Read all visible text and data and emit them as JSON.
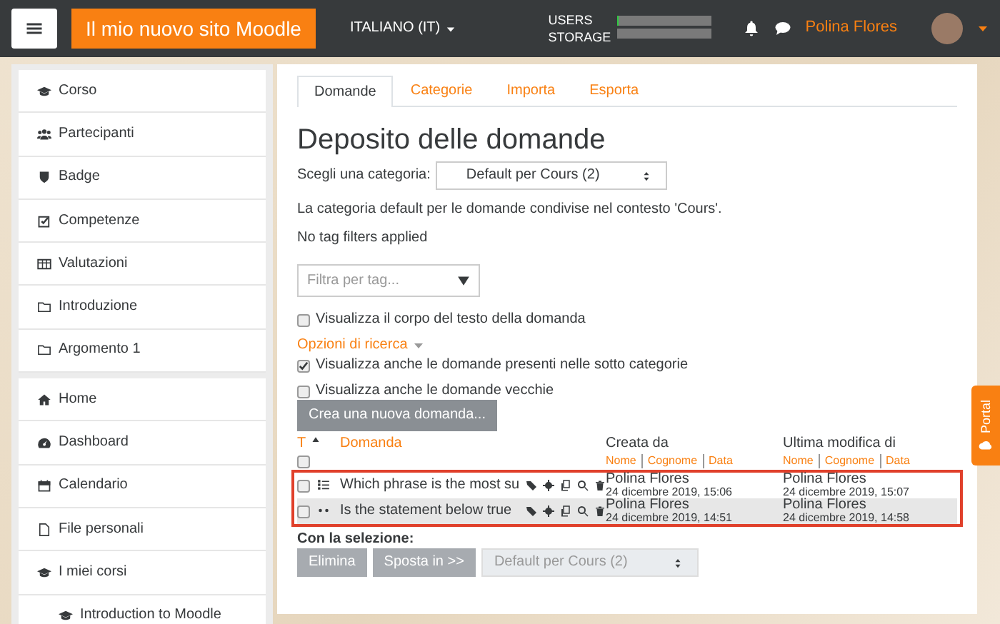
{
  "navbar": {
    "site_name": "Il mio nuovo sito Moodle",
    "language": "ITALIANO (IT)",
    "usage": [
      {
        "label": "USERS",
        "level": 0.02
      },
      {
        "label": "STORAGE",
        "level": 0
      }
    ],
    "user_name": "Polina Flores"
  },
  "sidebar": {
    "groups": [
      {
        "items": [
          {
            "kind": "cap",
            "label": "Corso"
          },
          {
            "kind": "users",
            "label": "Partecipanti"
          },
          {
            "kind": "shield",
            "label": "Badge"
          },
          {
            "kind": "check",
            "label": "Competenze"
          },
          {
            "kind": "table",
            "label": "Valutazioni"
          },
          {
            "kind": "folder",
            "label": "Introduzione"
          },
          {
            "kind": "folder",
            "label": "Argomento 1"
          }
        ]
      },
      {
        "items": [
          {
            "kind": "home",
            "label": "Home"
          },
          {
            "kind": "dashboard",
            "label": "Dashboard"
          },
          {
            "kind": "calendar",
            "label": "Calendario"
          },
          {
            "kind": "file",
            "label": "File personali"
          },
          {
            "kind": "cap",
            "label": "I miei corsi"
          },
          {
            "kind": "cap",
            "label": "Introduction to Moodle",
            "indented": true
          }
        ]
      }
    ]
  },
  "tabs": [
    {
      "label": "Domande",
      "selected": true
    },
    {
      "label": "Categorie",
      "selected": false
    },
    {
      "label": "Importa",
      "selected": false
    },
    {
      "label": "Esporta",
      "selected": false
    }
  ],
  "title": "Deposito delle domande",
  "category": {
    "label": "Scegli una categoria:",
    "value": "Default per Cours (2)"
  },
  "category_note": "La categoria default per le domande condivise nel contesto 'Cours'.",
  "tag_note": "No tag filters applied",
  "tag_filter": {
    "placeholder": "Filtra per tag..."
  },
  "show_text": {
    "label": "Visualizza il corpo del testo della domanda",
    "checked": false
  },
  "search_options": {
    "label": "Opzioni di ricerca",
    "options": [
      {
        "label": "Visualizza anche le domande presenti nelle sotto categorie",
        "checked": true
      },
      {
        "label": "Visualizza anche le domande vecchie",
        "checked": false
      }
    ]
  },
  "create_button": "Crea una nuova domanda...",
  "table": {
    "columns": {
      "type": "T",
      "question": "Domanda",
      "created": "Creata da",
      "modified": "Ultima modifica di"
    },
    "select_all_checked": false,
    "sort_links": [
      [
        "Nome",
        "Cognome",
        "Data"
      ],
      [
        "Nome",
        "Cognome",
        "Data"
      ]
    ],
    "rows": [
      {
        "checked": false,
        "kind": "multichoice",
        "text": "Which phrase is the most su",
        "creator": "Polina Flores",
        "created": "24 dicembre 2019, 15:06",
        "modifier": "Polina Flores",
        "modified": "24 dicembre 2019, 15:07"
      },
      {
        "checked": false,
        "kind": "truefalse",
        "text": "Is the statement below true",
        "creator": "Polina Flores",
        "created": "24 dicembre 2019, 14:51",
        "modifier": "Polina Flores",
        "modified": "24 dicembre 2019, 14:58"
      }
    ]
  },
  "selection": {
    "label": "Con la selezione:",
    "buttons": [
      "Elimina",
      "Sposta in >>"
    ],
    "target": "Default per Cours (2)"
  },
  "portal_tab": "Portal"
}
